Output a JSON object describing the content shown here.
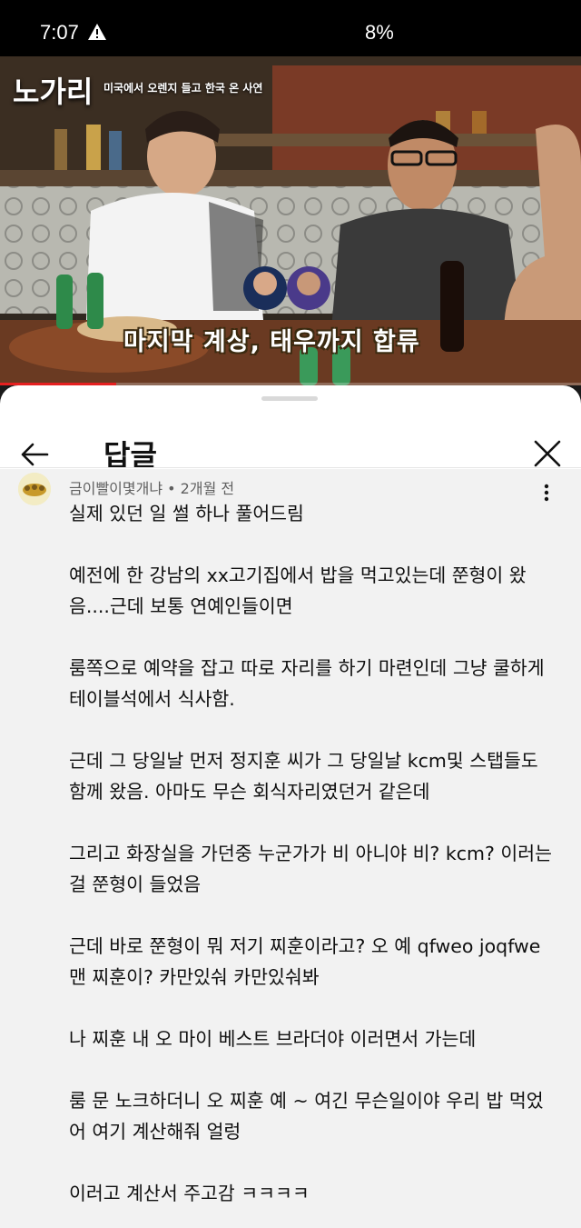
{
  "status_bar": {
    "time": "7:07",
    "battery": "8%"
  },
  "video": {
    "show_logo": "노가리",
    "subtitle": "미국에서 오렌지 들고 한국 온 사연",
    "caption": "마지막 계상, 태우까지 합류",
    "progress": 0.2
  },
  "sheet": {
    "title": "답글"
  },
  "comment": {
    "author": "금이빨이몇개냐",
    "time": "2개월 전",
    "paragraphs": [
      "실제 있던 일 썰 하나 풀어드림",
      "예전에 한 강남의 xx고기집에서 밥을 먹고있는데 쭌형이 왔음....근데 보통 연예인들이면",
      "룸쪽으로 예약을 잡고 따로 자리를 하기 마련인데 그냥 쿨하게 테이블석에서 식사함.",
      "근데 그 당일날 먼저 정지훈 씨가 그 당일날 kcm및 스탭들도 함께 왔음. 아마도 무슨 회식자리였던거 같은데",
      "그리고 화장실을 가던중 누군가가 비 아니야 비? kcm? 이러는 걸 쭌형이 들었음",
      "근데 바로 쭌형이 뭐 저기 찌훈이라고? 오 예 qfweo joqfwe 맨 찌훈이? 카만있숴 카만있숴봐",
      "나 찌훈 내 오 마이 베스트 브라더야 이러면서 가는데",
      "룸 문 노크하더니 오 찌훈 예 ~ 여긴 무슨일이야 우리 밥 먹었어 여기 계산해줘 얼렁",
      "이러고 계산서 주고감 ㅋㅋㅋㅋ"
    ]
  },
  "icons": {
    "status_warning": "warning-triangle-icon",
    "back": "arrow-left-icon",
    "close": "close-icon",
    "more": "more-vertical-icon"
  }
}
